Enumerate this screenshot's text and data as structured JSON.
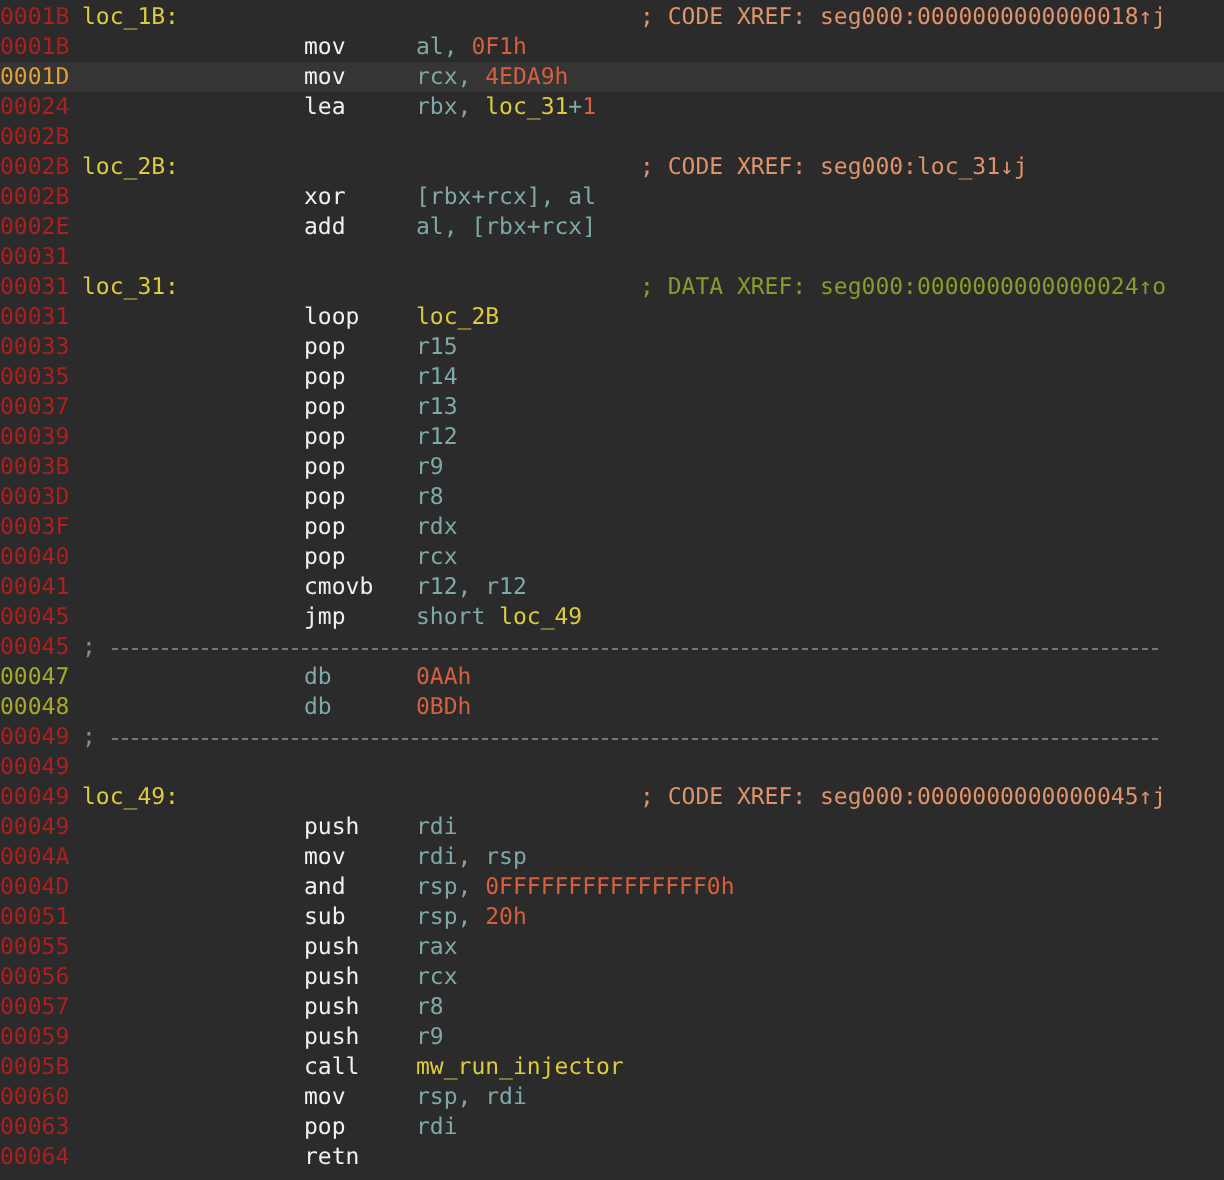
{
  "lines": [
    {
      "address": "0001B",
      "kind": "label",
      "selected": false,
      "label": "loc_1B:",
      "comment": {
        "text": "; CODE XREF: seg000:0000000000000018↑j",
        "kind": "code"
      }
    },
    {
      "address": "0001B",
      "kind": "instr",
      "selected": false,
      "mnemonic": "mov",
      "operands": [
        {
          "text": "al, ",
          "kind": "plain"
        },
        {
          "text": "0F1h",
          "kind": "num"
        }
      ]
    },
    {
      "address": "0001D",
      "kind": "instr",
      "selected": true,
      "mnemonic": "mov",
      "operands": [
        {
          "text": "rcx, ",
          "kind": "plain"
        },
        {
          "text": "4EDA9h",
          "kind": "num"
        }
      ]
    },
    {
      "address": "00024",
      "kind": "instr",
      "selected": false,
      "mnemonic": "lea",
      "operands": [
        {
          "text": "rbx, ",
          "kind": "plain"
        },
        {
          "text": "loc_31",
          "kind": "name"
        },
        {
          "text": "+",
          "kind": "plain"
        },
        {
          "text": "1",
          "kind": "num"
        }
      ]
    },
    {
      "address": "0002B",
      "kind": "blank",
      "selected": false
    },
    {
      "address": "0002B",
      "kind": "label",
      "selected": false,
      "label": "loc_2B:",
      "comment": {
        "text": "; CODE XREF: seg000:loc_31↓j",
        "kind": "code"
      }
    },
    {
      "address": "0002B",
      "kind": "instr",
      "selected": false,
      "mnemonic": "xor",
      "operands": [
        {
          "text": "[rbx+rcx], al",
          "kind": "plain"
        }
      ]
    },
    {
      "address": "0002E",
      "kind": "instr",
      "selected": false,
      "mnemonic": "add",
      "operands": [
        {
          "text": "al, [rbx+rcx]",
          "kind": "plain"
        }
      ]
    },
    {
      "address": "00031",
      "kind": "blank",
      "selected": false
    },
    {
      "address": "00031",
      "kind": "label",
      "selected": false,
      "label": "loc_31:",
      "comment": {
        "text": "; DATA XREF: seg000:0000000000000024↑o",
        "kind": "data"
      }
    },
    {
      "address": "00031",
      "kind": "instr",
      "selected": false,
      "mnemonic": "loop",
      "operands": [
        {
          "text": "loc_2B",
          "kind": "name"
        }
      ]
    },
    {
      "address": "00033",
      "kind": "instr",
      "selected": false,
      "mnemonic": "pop",
      "operands": [
        {
          "text": "r15",
          "kind": "plain"
        }
      ]
    },
    {
      "address": "00035",
      "kind": "instr",
      "selected": false,
      "mnemonic": "pop",
      "operands": [
        {
          "text": "r14",
          "kind": "plain"
        }
      ]
    },
    {
      "address": "00037",
      "kind": "instr",
      "selected": false,
      "mnemonic": "pop",
      "operands": [
        {
          "text": "r13",
          "kind": "plain"
        }
      ]
    },
    {
      "address": "00039",
      "kind": "instr",
      "selected": false,
      "mnemonic": "pop",
      "operands": [
        {
          "text": "r12",
          "kind": "plain"
        }
      ]
    },
    {
      "address": "0003B",
      "kind": "instr",
      "selected": false,
      "mnemonic": "pop",
      "operands": [
        {
          "text": "r9",
          "kind": "plain"
        }
      ]
    },
    {
      "address": "0003D",
      "kind": "instr",
      "selected": false,
      "mnemonic": "pop",
      "operands": [
        {
          "text": "r8",
          "kind": "plain"
        }
      ]
    },
    {
      "address": "0003F",
      "kind": "instr",
      "selected": false,
      "mnemonic": "pop",
      "operands": [
        {
          "text": "rdx",
          "kind": "plain"
        }
      ]
    },
    {
      "address": "00040",
      "kind": "instr",
      "selected": false,
      "mnemonic": "pop",
      "operands": [
        {
          "text": "rcx",
          "kind": "plain"
        }
      ]
    },
    {
      "address": "00041",
      "kind": "instr",
      "selected": false,
      "mnemonic": "cmovb",
      "operands": [
        {
          "text": "r12, r12",
          "kind": "plain"
        }
      ]
    },
    {
      "address": "00045",
      "kind": "instr",
      "selected": false,
      "mnemonic": "jmp",
      "operands": [
        {
          "text": "short ",
          "kind": "plain"
        },
        {
          "text": "loc_49",
          "kind": "name"
        }
      ]
    },
    {
      "address": "00045",
      "kind": "separator",
      "selected": false,
      "text": ";"
    },
    {
      "address": "00047",
      "kind": "data",
      "selected": false,
      "mnemonic": "db",
      "operands": [
        {
          "text": "0AAh",
          "kind": "num"
        }
      ]
    },
    {
      "address": "00048",
      "kind": "data",
      "selected": false,
      "mnemonic": "db",
      "operands": [
        {
          "text": "0BDh",
          "kind": "num"
        }
      ]
    },
    {
      "address": "00049",
      "kind": "separator",
      "selected": false,
      "text": ";"
    },
    {
      "address": "00049",
      "kind": "blank",
      "selected": false
    },
    {
      "address": "00049",
      "kind": "label",
      "selected": false,
      "label": "loc_49:",
      "comment": {
        "text": "; CODE XREF: seg000:0000000000000045↑j",
        "kind": "code"
      }
    },
    {
      "address": "00049",
      "kind": "instr",
      "selected": false,
      "mnemonic": "push",
      "operands": [
        {
          "text": "rdi",
          "kind": "plain"
        }
      ]
    },
    {
      "address": "0004A",
      "kind": "instr",
      "selected": false,
      "mnemonic": "mov",
      "operands": [
        {
          "text": "rdi, rsp",
          "kind": "plain"
        }
      ]
    },
    {
      "address": "0004D",
      "kind": "instr",
      "selected": false,
      "mnemonic": "and",
      "operands": [
        {
          "text": "rsp, ",
          "kind": "plain"
        },
        {
          "text": "0FFFFFFFFFFFFFFF0h",
          "kind": "num"
        }
      ]
    },
    {
      "address": "00051",
      "kind": "instr",
      "selected": false,
      "mnemonic": "sub",
      "operands": [
        {
          "text": "rsp, ",
          "kind": "plain"
        },
        {
          "text": "20h",
          "kind": "num"
        }
      ]
    },
    {
      "address": "00055",
      "kind": "instr",
      "selected": false,
      "mnemonic": "push",
      "operands": [
        {
          "text": "rax",
          "kind": "plain"
        }
      ]
    },
    {
      "address": "00056",
      "kind": "instr",
      "selected": false,
      "mnemonic": "push",
      "operands": [
        {
          "text": "rcx",
          "kind": "plain"
        }
      ]
    },
    {
      "address": "00057",
      "kind": "instr",
      "selected": false,
      "mnemonic": "push",
      "operands": [
        {
          "text": "r8",
          "kind": "plain"
        }
      ]
    },
    {
      "address": "00059",
      "kind": "instr",
      "selected": false,
      "mnemonic": "push",
      "operands": [
        {
          "text": "r9",
          "kind": "plain"
        }
      ]
    },
    {
      "address": "0005B",
      "kind": "instr",
      "selected": false,
      "mnemonic": "call",
      "operands": [
        {
          "text": "mw_run_injector",
          "kind": "name"
        }
      ]
    },
    {
      "address": "00060",
      "kind": "instr",
      "selected": false,
      "mnemonic": "mov",
      "operands": [
        {
          "text": "rsp, rdi",
          "kind": "plain"
        }
      ]
    },
    {
      "address": "00063",
      "kind": "instr",
      "selected": false,
      "mnemonic": "pop",
      "operands": [
        {
          "text": "rdi",
          "kind": "plain"
        }
      ]
    },
    {
      "address": "00064",
      "kind": "instr",
      "selected": false,
      "mnemonic": "retn"
    }
  ]
}
